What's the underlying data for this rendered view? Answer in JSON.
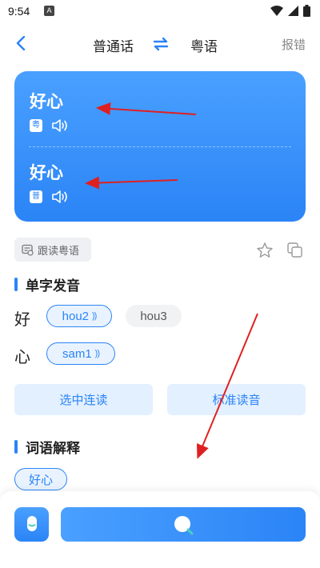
{
  "status_bar": {
    "time": "9:54",
    "notification_letter": "A"
  },
  "nav": {
    "source_lang": "普通话",
    "target_lang": "粤语",
    "report_label": "报错"
  },
  "translation_card": {
    "entries": [
      {
        "text": "好心",
        "tag": "粤"
      },
      {
        "text": "好心",
        "tag": "普"
      }
    ]
  },
  "tools": {
    "follow_read_label": "跟读粤语"
  },
  "pronunciation": {
    "title": "单字发音",
    "chars": [
      {
        "char": "好",
        "readings": [
          {
            "label": "hou2",
            "selected": true
          },
          {
            "label": "hou3",
            "selected": false
          }
        ]
      },
      {
        "char": "心",
        "readings": [
          {
            "label": "sam1",
            "selected": true
          }
        ]
      }
    ],
    "buttons": {
      "continuous": "选中连读",
      "standard": "标准读音"
    }
  },
  "definition": {
    "title": "词语解释",
    "word_chip": "好心"
  },
  "colors": {
    "accent": "#2b84f6",
    "annotation_arrow": "#e02020"
  },
  "icons": [
    "back-arrow-icon",
    "swap-icon",
    "speaker-icon",
    "star-icon",
    "copy-icon",
    "microphone-icon",
    "search-icon"
  ]
}
